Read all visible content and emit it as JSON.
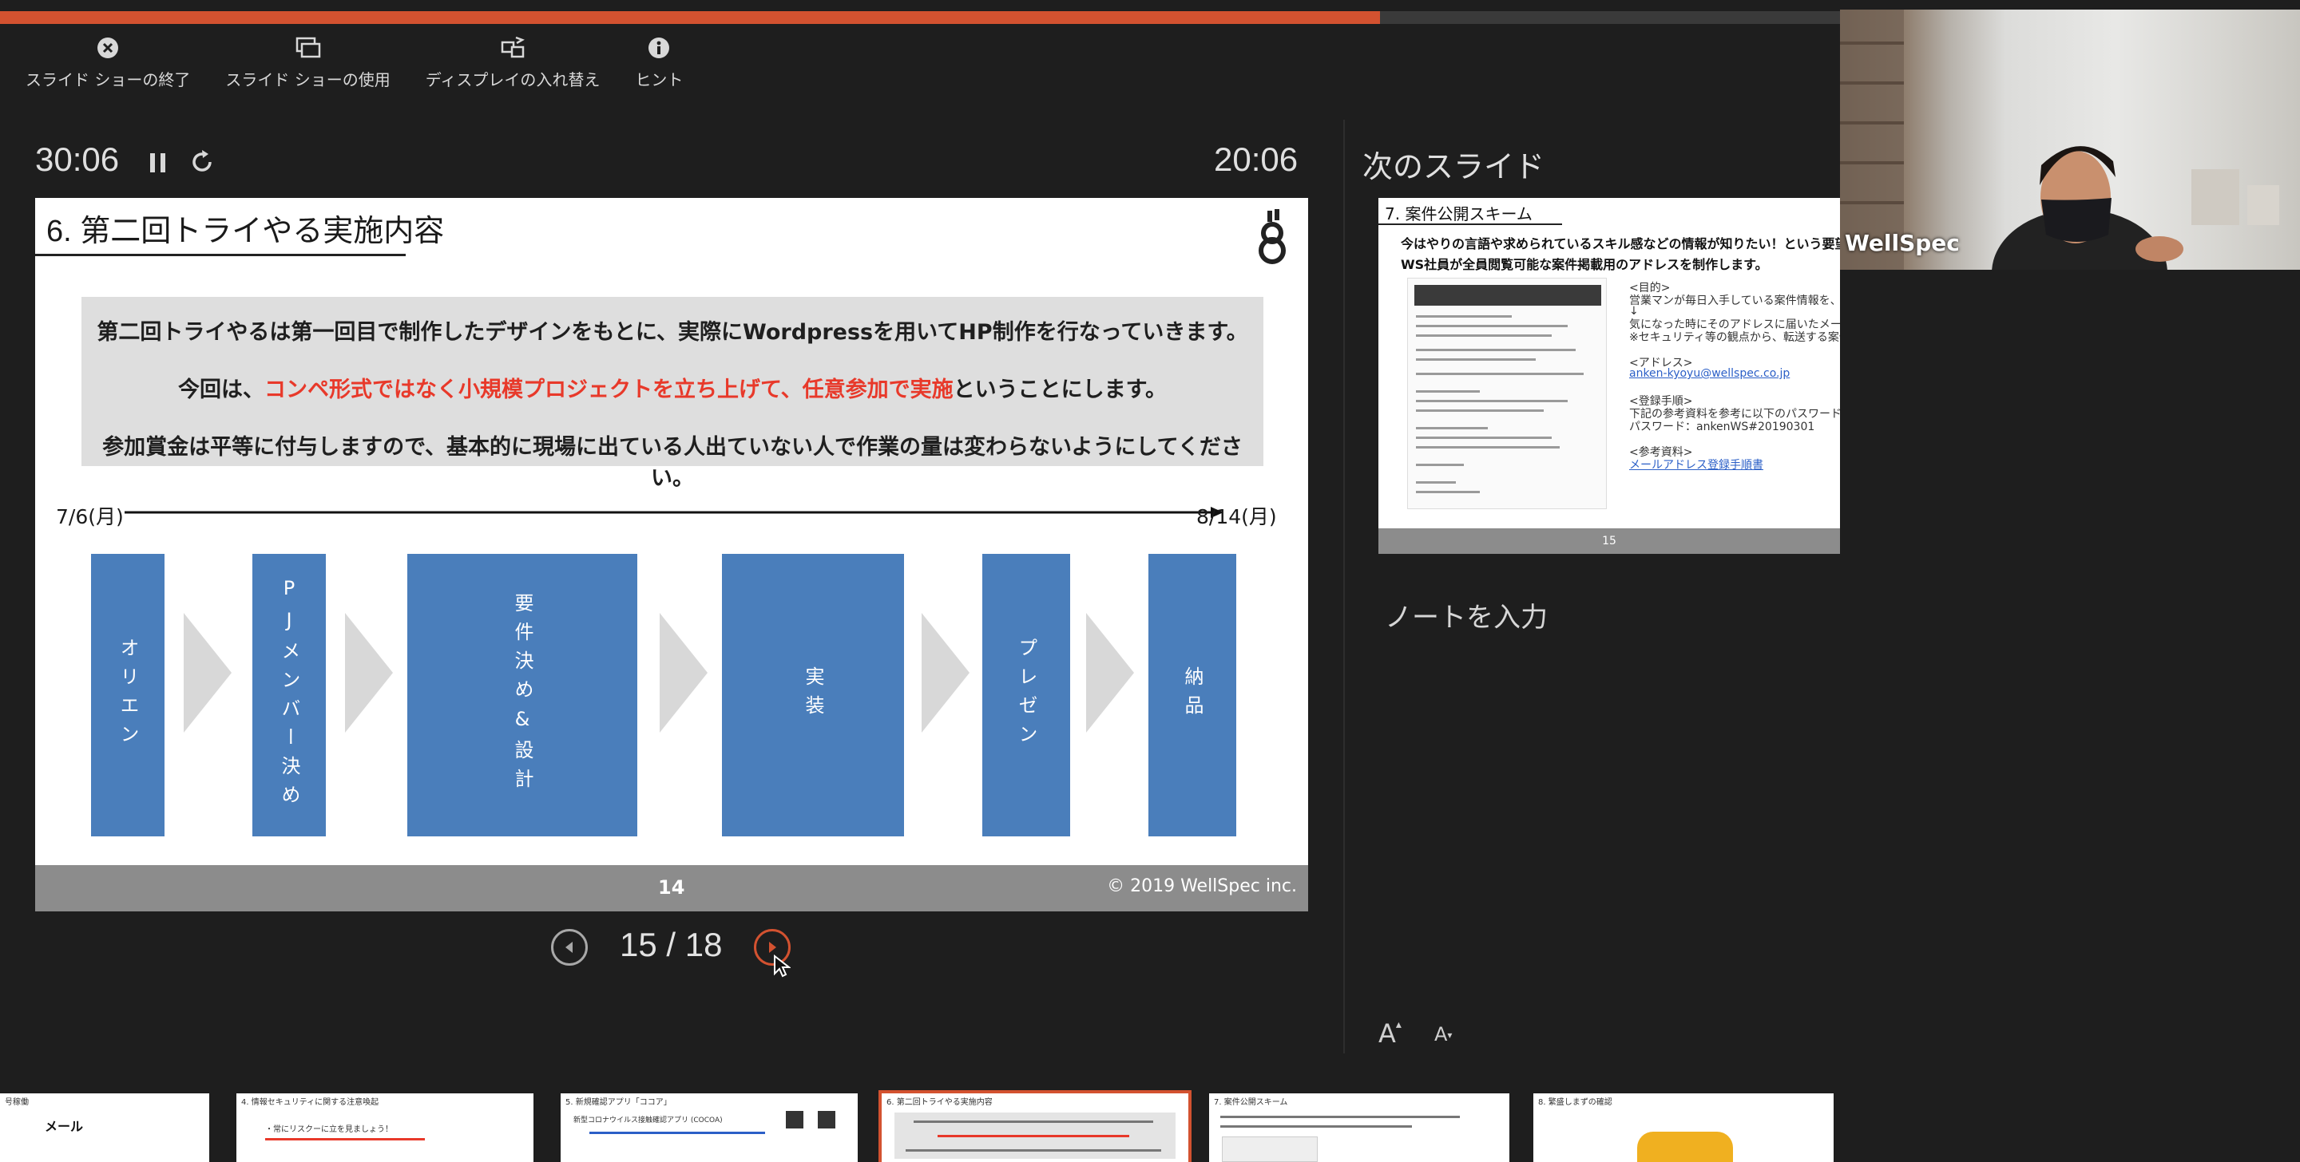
{
  "progress": {
    "fraction": 0.75,
    "color": "#d35230"
  },
  "toolbar": {
    "items": [
      {
        "label": "スライド ショーの終了",
        "icon": "close-circle-icon"
      },
      {
        "label": "スライド ショーの使用",
        "icon": "duplicate-screens-icon"
      },
      {
        "label": "ディスプレイの入れ替え",
        "icon": "swap-display-icon"
      },
      {
        "label": "ヒント",
        "icon": "info-icon"
      }
    ]
  },
  "timer": {
    "elapsed": "30:06",
    "clock": "20:06"
  },
  "navigator": {
    "current": "15 / 18"
  },
  "main_slide": {
    "title": "6. 第二回トライやる実施内容",
    "line1": "第二回トライやるは第一回目で制作したデザインをもとに、実際にWordpressを用いてHP制作を行なっていきます。",
    "line2_prefix": "今回は、",
    "line2_red": "コンペ形式ではなく小規模プロジェクトを立ち上げて、任意参加で実施",
    "line2_suffix": "ということにします。",
    "line3": "参加賞金は平等に付与しますので、基本的に現場に出ている人出ていない人で作業の量は変わらないようにしてください。",
    "date_start": "7/6(月)",
    "date_end": "8/14(月)",
    "steps": [
      "オリエン",
      "PJメンバー決め",
      "要件決め&設計",
      "実装",
      "プレゼン",
      "納品"
    ],
    "page_number": "14",
    "copyright": "© 2019 WellSpec inc.",
    "accent": "#e8392a",
    "step_color": "#4a7ebb"
  },
  "next_slide": {
    "label": "次のスライド",
    "title": "7. 案件公開スキーム",
    "line1": "今はやりの言語や求められているスキル感などの情報が知りたい！という要望がありましたので",
    "line2": "WS社員が全員閲覧可能な案件掲載用のアドレスを制作します。",
    "purpose_head": "<目的>",
    "purpose_1": "営業マンが毎日入手している案件情報を、定期的",
    "purpose_arrow": "↓",
    "purpose_2": "気になった時にそのアドレスに届いたメールを見て、",
    "purpose_3": "※セキュリティ等の観点から、転送する案件内容は",
    "address_head": "<アドレス>",
    "address": "anken-kyoyu@wellspec.co.jp",
    "register_head": "<登録手順>",
    "register_1": "下記の参考資料を参考に以下のパスワードで登録",
    "register_2": "パスワード：ankenWS#20190301",
    "ref_head": "<参考資料>",
    "ref_link": "メールアドレス登録手順書",
    "page_number": "15"
  },
  "notes": {
    "placeholder": "ノートを入力"
  },
  "font_controls": {
    "increase": "A",
    "decrease": "A"
  },
  "webcam": {
    "name": "WellSpec"
  },
  "thumbnails": [
    {
      "title": "号稼働",
      "line": "メール"
    },
    {
      "title": "4. 情報セキュリティに関する注意喚起",
      "line": "・常にリスクーに立を見ましょう！"
    },
    {
      "title": "5. 新規確認アプリ「ココア」",
      "line": "新型コロナウイルス接触確認アプリ (COCOA)"
    },
    {
      "title": "6. 第二回トライやる実施内容",
      "line": ""
    },
    {
      "title": "7. 案件公開スキーム",
      "line": ""
    },
    {
      "title": "8. 繁盛しまずの確認",
      "line": ""
    }
  ]
}
